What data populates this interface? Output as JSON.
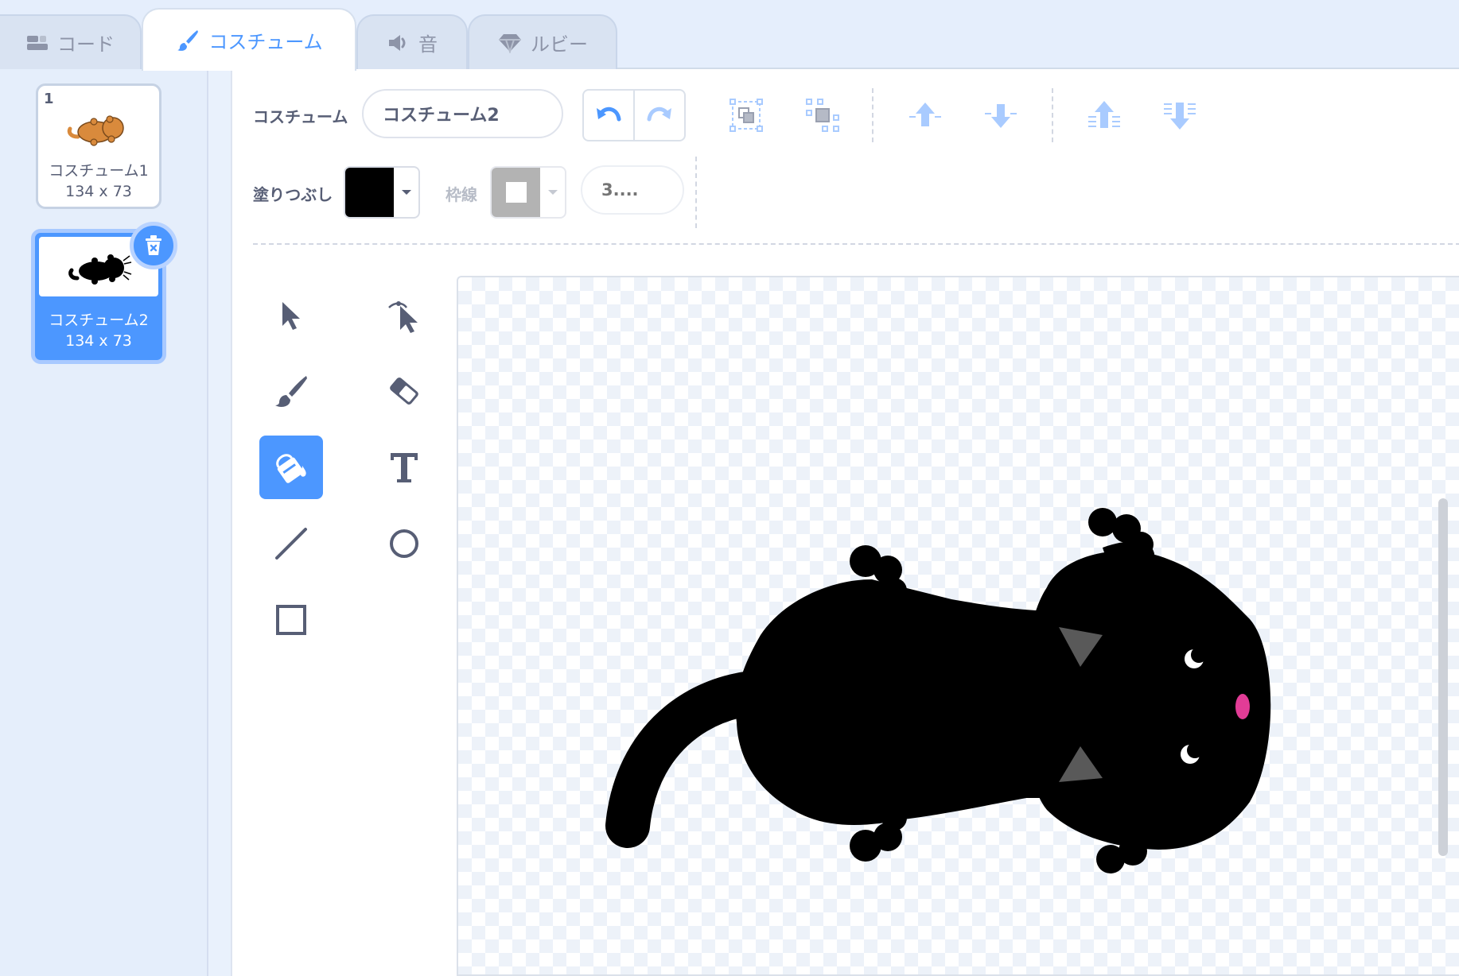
{
  "tabs": [
    {
      "label": "コード",
      "icon": "code-blocks-icon",
      "active": false
    },
    {
      "label": "コスチューム",
      "icon": "paintbrush-icon",
      "active": true
    },
    {
      "label": "音",
      "icon": "speaker-icon",
      "active": false
    },
    {
      "label": "ルビー",
      "icon": "ruby-gem-icon",
      "active": false
    }
  ],
  "costumes": [
    {
      "number": "1",
      "name": "コスチューム1",
      "size": "134 x 73",
      "selected": false,
      "thumb_color": "#d98a3c"
    },
    {
      "number": "2",
      "name": "コスチューム2",
      "size": "134 x 73",
      "selected": true,
      "thumb_color": "#000000"
    }
  ],
  "toolbar": {
    "costume_label": "コスチューム",
    "costume_name_value": "コスチューム2",
    "fill_label": "塗りつぶし",
    "fill_color": "#000000",
    "outline_label": "枠線",
    "outline_color": "#b3b3b3",
    "outline_width_placeholder": "3...."
  },
  "tools": [
    "select-tool",
    "reshape-tool",
    "brush-tool",
    "eraser-tool",
    "fill-tool",
    "text-tool",
    "line-tool",
    "circle-tool",
    "rectangle-tool"
  ],
  "active_tool": "fill-tool",
  "colors": {
    "accent": "#4c97ff",
    "text": "#575e75",
    "cat_body": "#000000",
    "cat_ear_inner": "#595959",
    "cat_nose": "#e23c96"
  }
}
